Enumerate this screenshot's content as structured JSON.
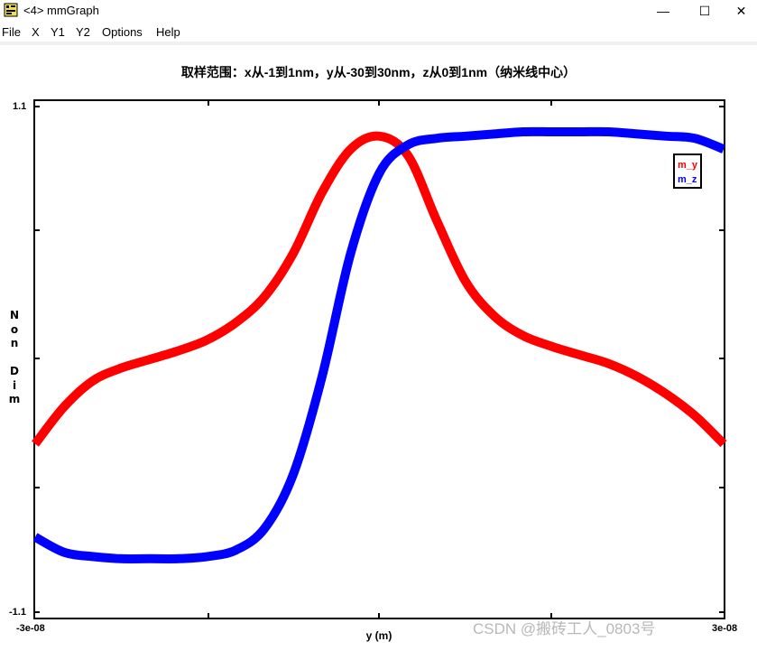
{
  "window": {
    "title": "<4> mmGraph",
    "icon": "mmgraph-app-icon",
    "minimize_glyph": "—",
    "maximize_glyph": "☐",
    "close_glyph": "✕"
  },
  "menu": {
    "items": [
      "File",
      "X",
      "Y1",
      "Y2",
      "Options",
      "Help"
    ]
  },
  "watermark": "CSDN @搬砖工人_0803号",
  "chart_data": {
    "type": "line",
    "title": "取样范围：x从-1到1nm，y从-30到30nm，z从0到1nm（纳米线中心）",
    "xlabel": "y (m)",
    "ylabel": "N\no\nn\n\nD\ni\nm",
    "xlim": [
      -3e-08,
      3e-08
    ],
    "ylim": [
      -1.1,
      1.1
    ],
    "x_tick_labels": [
      "-3e-08",
      "3e-08"
    ],
    "y_tick_labels": [
      "1.1",
      "-1.1"
    ],
    "legend": {
      "position": "top-right",
      "entries": [
        "m_y",
        "m_z"
      ]
    },
    "x": [
      -3e-08,
      -2.75e-08,
      -2.5e-08,
      -2.25e-08,
      -2e-08,
      -1.75e-08,
      -1.5e-08,
      -1.25e-08,
      -1e-08,
      -7.5e-09,
      -5e-09,
      -2.5e-09,
      0,
      2.5e-09,
      5e-09,
      7.5e-09,
      1e-08,
      1.25e-08,
      1.5e-08,
      1.75e-08,
      2e-08,
      2.25e-08,
      2.5e-08,
      2.75e-08,
      3e-08
    ],
    "series": [
      {
        "name": "m_y",
        "color": "#ff0000",
        "values": [
          -0.39,
          -0.22,
          -0.1,
          -0.04,
          0.0,
          0.04,
          0.09,
          0.17,
          0.29,
          0.49,
          0.77,
          0.97,
          1.03,
          0.94,
          0.64,
          0.36,
          0.2,
          0.11,
          0.06,
          0.02,
          -0.02,
          -0.08,
          -0.16,
          -0.26,
          -0.39
        ]
      },
      {
        "name": "m_z",
        "color": "#0000ff",
        "values": [
          -0.82,
          -0.89,
          -0.91,
          -0.92,
          -0.92,
          -0.92,
          -0.91,
          -0.88,
          -0.78,
          -0.53,
          -0.08,
          0.49,
          0.86,
          0.99,
          1.02,
          1.03,
          1.04,
          1.05,
          1.05,
          1.05,
          1.05,
          1.04,
          1.03,
          1.02,
          0.97
        ]
      }
    ],
    "line_width": 10
  }
}
